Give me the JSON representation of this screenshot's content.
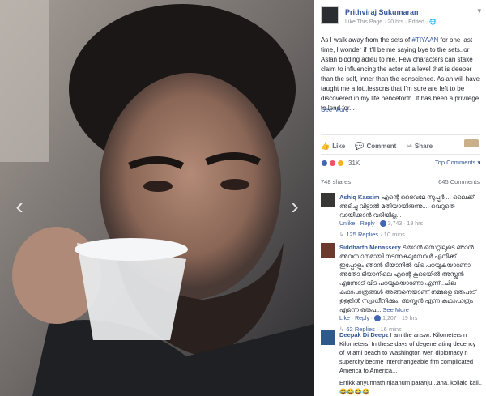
{
  "viewer": {
    "prev_arrow": "‹",
    "next_arrow": "›"
  },
  "post": {
    "page_name": "Prithviraj Sukumaran",
    "like_page": "Like This Page",
    "meta_rest": " · 20 hrs · Edited · ",
    "menu_caret": "▾",
    "text_before_hash": "As I walk away from the sets of ",
    "hashtag": "#TIYAAN",
    "text_after_hash": " for one last time, I wonder if it'll be me saying bye to the sets..or Aslan bidding adieu to me. Few characters can stake claim to influencing the actor at a level that is deeper than the self, inner than the conscience. Aslan will have taught me a lot..lessons that I'm sure are left to be discovered in my life henceforth. It has been a privilege to lend for...",
    "see_more": "See More"
  },
  "actions": {
    "like": "Like",
    "comment": "Comment",
    "share": "Share",
    "like_icon": "👍",
    "comment_icon": "💬",
    "share_icon": "↪"
  },
  "stats": {
    "reactions": "31K",
    "top_comments": "Top Comments ▾",
    "shares": "748 shares",
    "comments": "645 Comments"
  },
  "comments": [
    {
      "name": "Ashiq Kassim",
      "text": "എന്റെ ദൈവമേ സൂപ്പർ.... ലൈക്ക് അടിച്ചു വിട്ടാൽ മതിയായിരുന്നു.... വെറുതെ വായിക്കാൻ വരിയില്ല...",
      "unlike": "Unlike",
      "reply": "Reply",
      "count": "3,743",
      "time": "19 hrs",
      "replies": "125 Replies",
      "replies_time": "10 mins"
    },
    {
      "name": "Siddharth Menassery",
      "text": "ടിയാൻ സെറ്റിലൂടെ ഞാൻ അവസാനമായി നടന്നകലുമ്പോൾ എനിക്ക് ഇപ്പോളും ഞാൻ ടിയാനിൽ വിട പറയുകയാണോ അതോ ടിയാനിലെ എന്റെ കൂടെയിൽ അസ്ലൻ എന്നോട് വിട പറയുകയാണോ എന്ന്..ചില കഥാപാത്രങ്ങൾ അങ്ങനെയാണ് നമ്മളെ ഒരുപാട് ഉള്ളിൽ സ്വാധീനിക്കും. അസ്ലൻ എന്ന കഥാപാത്രം എന്നെ ഒരുപ...",
      "see_more": "See More",
      "like": "Like",
      "reply": "Reply",
      "count": "1,207",
      "time": "19 hrs",
      "replies": "62 Replies",
      "replies_time": "16 mins"
    },
    {
      "name": "Deepak Di Deepz",
      "text": "I am the answr. Kilometers n Kilometers: In these days of degenerating decency of Miami beach to Washington wen diplomacy n supercity becme interchangeable frm complicated America to America...",
      "reply_text": "Errikk anyunnath njaanum paranju...aha, kollalo kali.. 😂😂😂😂"
    }
  ],
  "colors": {
    "link": "#365899",
    "meta": "#90949c",
    "panel_bg": "#ffffff"
  }
}
